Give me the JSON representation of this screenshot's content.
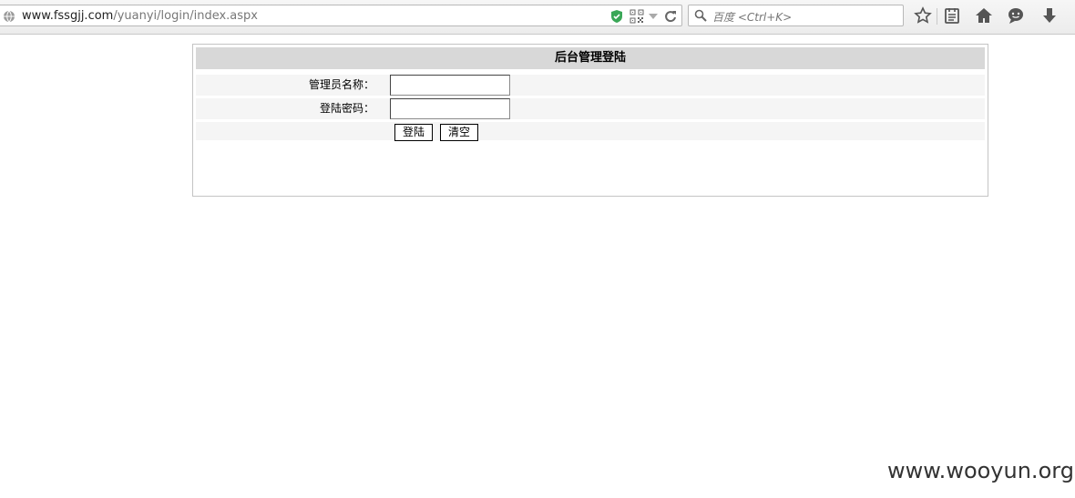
{
  "browser": {
    "url_domain": "www.fssgjj.com",
    "url_path": "/yuanyi/login/index.aspx",
    "search_placeholder": "百度 <Ctrl+K>",
    "icons": [
      "globe-icon",
      "shield-check-icon",
      "qr-code-icon",
      "dropdown-arrow-icon",
      "reload-icon",
      "search-icon",
      "bookmark-star-icon",
      "reading-list-icon",
      "home-icon",
      "chat-icon",
      "download-icon"
    ],
    "accent": "#3aa757"
  },
  "login": {
    "title": "后台管理登陆",
    "username_label": "管理员名称：",
    "password_label": "登陆密码：",
    "username_value": "",
    "password_value": "",
    "login_button": "登陆",
    "clear_button": "清空",
    "header_bg": "#d8d8d8",
    "row_bg": "#f5f5f5"
  },
  "watermark": "www.wooyun.org"
}
